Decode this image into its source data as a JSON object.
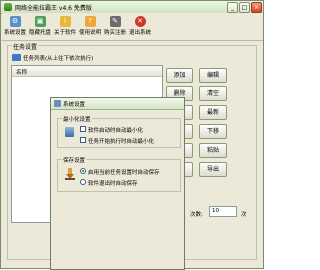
{
  "window": {
    "title": "网络全能拉霸王 v4.6 免费版",
    "minimize_glyph": "_",
    "maximize_glyph": "□",
    "close_glyph": "×"
  },
  "toolbar": {
    "items": [
      {
        "label": "系统设置",
        "icon": "settings-icon",
        "color": "#5b8fc9"
      },
      {
        "label": "隐藏托盘",
        "icon": "tray-icon",
        "color": "#4aa05a"
      },
      {
        "label": "关于软件",
        "icon": "info-icon",
        "color": "#e6b93a"
      },
      {
        "label": "使用说明",
        "icon": "help-icon",
        "color": "#f0a73a"
      },
      {
        "label": "购买注册",
        "icon": "register-icon",
        "color": "#6b6b6b"
      },
      {
        "label": "退出系统",
        "icon": "exit-icon",
        "color": "#d0372b"
      }
    ]
  },
  "task_group": {
    "caption": "任务设置",
    "list_caption": "任务列表(从上往下依次执行)",
    "column_name": "名称"
  },
  "side_buttons": {
    "left": [
      "添加",
      "删除",
      "",
      "",
      "",
      ""
    ],
    "right": [
      "编辑",
      "清空",
      "最新",
      "下移",
      "粘贴",
      "导出"
    ]
  },
  "bottom": {
    "loop_label": "次数:",
    "loop_value": "10",
    "loop_unit": "次"
  },
  "dialog": {
    "title": "系统设置",
    "minimize_group": {
      "caption": "最小化设置",
      "options": [
        "软件启动时自动最小化",
        "任务开始执行时自动最小化"
      ]
    },
    "save_group": {
      "caption": "保存设置",
      "options": [
        "启用当前任务设置时自动保存",
        "软件退出时自动保存"
      ],
      "selected": 0
    }
  }
}
